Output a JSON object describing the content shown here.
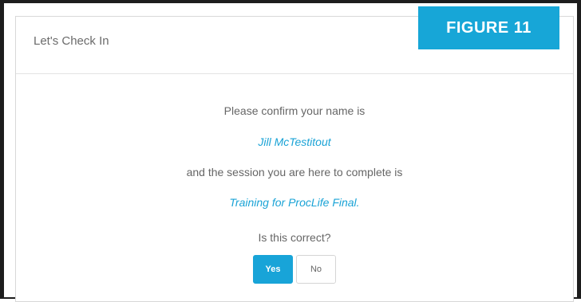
{
  "dialog": {
    "title": "Let's Check In",
    "confirm_name_text": "Please confirm your name is",
    "user_name": "Jill McTestitout",
    "session_text": "and the session you are here to complete is",
    "session_name": "Training for ProcLife Final.",
    "question": "Is this correct?",
    "yes_label": "Yes",
    "no_label": "No"
  },
  "figure_label": "FIGURE 11",
  "colors": {
    "accent": "#18a4d8",
    "text": "#666666",
    "frame": "#1d1d1d"
  }
}
